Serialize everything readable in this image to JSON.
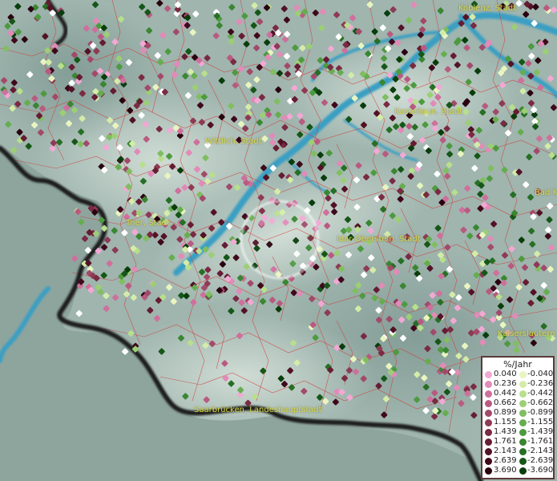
{
  "map": {
    "cities": [
      {
        "name": "Koblenz, Stadt"
      },
      {
        "name": "Kastellaun, Stadt"
      },
      {
        "name": "Wittlich, Stadt"
      },
      {
        "name": "Trier, Stadt"
      },
      {
        "name": "Idar-Oberstein, Stadt"
      },
      {
        "name": "Bad K"
      },
      {
        "name": "Kaiserslautern"
      },
      {
        "name": "Saarbrücken, Landeshauptstadt"
      }
    ]
  },
  "legend": {
    "unit": "%/Jahr",
    "positive": [
      "0.040",
      "0.236",
      "0.442",
      "0.662",
      "0.899",
      "1.155",
      "1.439",
      "1.761",
      "2.143",
      "2.639",
      "3.690"
    ],
    "negative": [
      "-0.040",
      "-0.236",
      "-0.442",
      "-0.662",
      "-0.899",
      "-1.155",
      "-1.439",
      "-1.761",
      "-2.143",
      "-2.639",
      "-3.690"
    ],
    "positive_colors": [
      "#f2a8d4",
      "#e28ab8",
      "#cf6f9c",
      "#b95a80",
      "#a24a6a",
      "#8e3a55",
      "#7a2a42",
      "#661c32",
      "#531226",
      "#40081b",
      "#2a0210"
    ],
    "negative_colors": [
      "#e9f5c0",
      "#d4eca8",
      "#b8df8c",
      "#9ccf74",
      "#80be60",
      "#66ad4f",
      "#4e9a40",
      "#3a8632",
      "#276f25",
      "#165717",
      "#093e0c"
    ]
  }
}
